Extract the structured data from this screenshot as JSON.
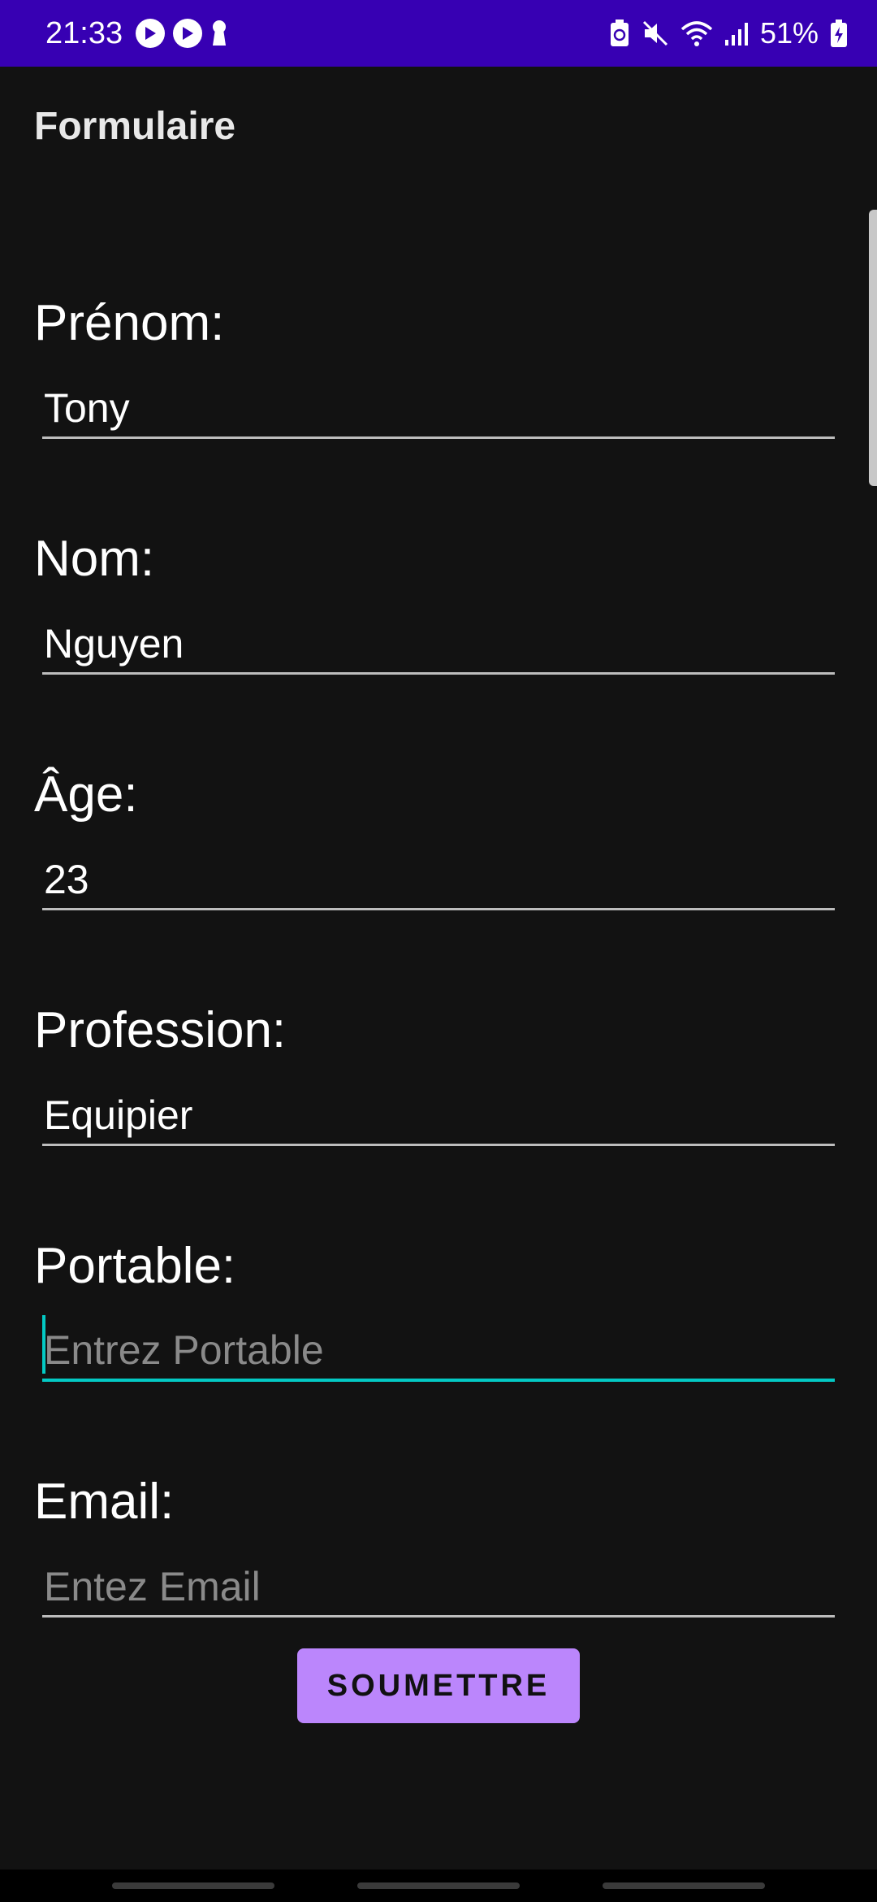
{
  "status_bar": {
    "time": "21:33",
    "battery": "51%",
    "background_color": "#3700b3"
  },
  "app": {
    "title": "Formulaire"
  },
  "form": {
    "fields": [
      {
        "label": "Prénom:",
        "value": "Tony",
        "placeholder": ""
      },
      {
        "label": "Nom:",
        "value": "Nguyen",
        "placeholder": ""
      },
      {
        "label": "Âge:",
        "value": "23",
        "placeholder": ""
      },
      {
        "label": "Profession:",
        "value": "Equipier",
        "placeholder": ""
      },
      {
        "label": "Portable:",
        "value": "",
        "placeholder": "Entrez Portable"
      },
      {
        "label": "Email:",
        "value": "",
        "placeholder": "Entez Email"
      }
    ],
    "submit_label": "SOUMETTRE",
    "accent_color": "#03c9c4",
    "button_color": "#bb86fc"
  }
}
